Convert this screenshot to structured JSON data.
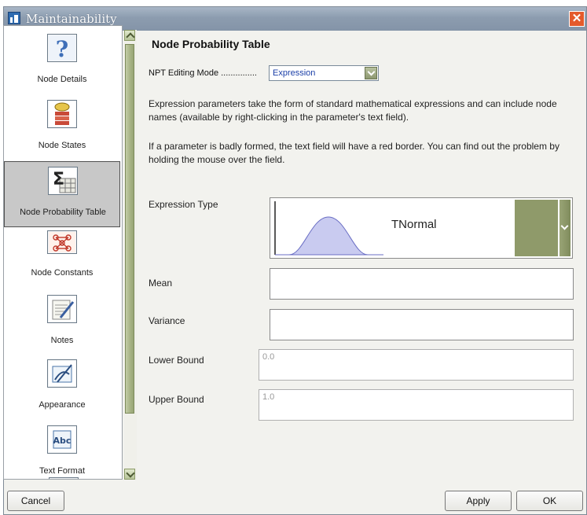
{
  "window": {
    "title": "Maintainability"
  },
  "sidebar": {
    "items": [
      {
        "label": "Node Details",
        "icon": "question-icon"
      },
      {
        "label": "Node States",
        "icon": "node-states-icon"
      },
      {
        "label": "Node Probability Table",
        "icon": "sigma-table-icon",
        "selected": true
      },
      {
        "label": "Node Constants",
        "icon": "constants-icon"
      },
      {
        "label": "Notes",
        "icon": "notes-icon"
      },
      {
        "label": "Appearance",
        "icon": "appearance-icon"
      },
      {
        "label": "Text Format",
        "icon": "text-format-icon"
      }
    ]
  },
  "main": {
    "title": "Node Probability Table",
    "npt_label": "NPT Editing Mode ...............",
    "npt_value": "Expression",
    "para1": "Expression parameters take the form of standard mathematical expressions and can include node names (available by right-clicking in the parameter's text field).",
    "para2": "If a parameter is badly formed, the text field will have a red border. You can find out the problem by holding the mouse over the field.",
    "expression_type_label": "Expression Type",
    "expression_type_value": "TNormal",
    "mean_label": "Mean",
    "mean_value": "",
    "variance_label": "Variance",
    "variance_value": "",
    "lower_bound_label": "Lower Bound",
    "lower_bound_value": "0.0",
    "upper_bound_label": "Upper Bound",
    "upper_bound_value": "1.0"
  },
  "buttons": {
    "cancel": "Cancel",
    "apply": "Apply",
    "ok": "OK"
  },
  "colors": {
    "titlebar": "#8c9caf",
    "accent": "#8f9a6a",
    "close": "#e45a2c",
    "selected": "#c8c8c8"
  }
}
